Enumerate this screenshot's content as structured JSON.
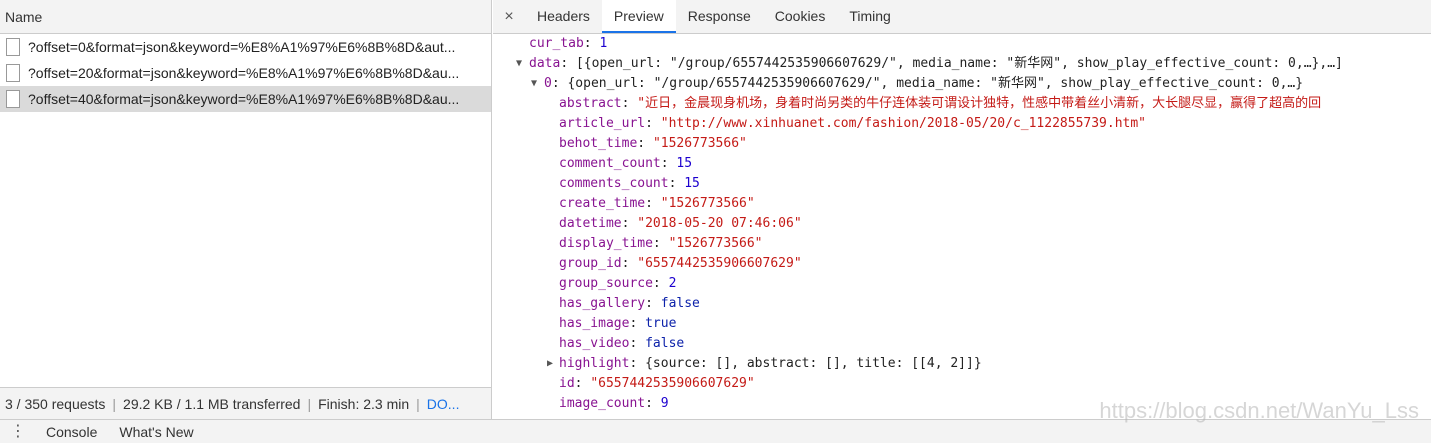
{
  "left": {
    "header": "Name",
    "requests": [
      "?offset=0&format=json&keyword=%E8%A1%97%E6%8B%8D&aut...",
      "?offset=20&format=json&keyword=%E8%A1%97%E6%8B%8D&au...",
      "?offset=40&format=json&keyword=%E8%A1%97%E6%8B%8D&au..."
    ],
    "status": {
      "requests": "3 / 350 requests",
      "transferred": "29.2 KB / 1.1 MB transferred",
      "finish": "Finish: 2.3 min",
      "dom": "DO..."
    }
  },
  "tabs": {
    "close": "×",
    "items": [
      "Headers",
      "Preview",
      "Response",
      "Cookies",
      "Timing"
    ],
    "active": "Preview"
  },
  "preview": {
    "cur_tab": {
      "key": "cur_tab",
      "value": "1"
    },
    "data": {
      "key": "data",
      "summary": "[{open_url: \"/group/6557442535906607629/\", media_name: \"新华网\", show_play_effective_count: 0,…},…]"
    },
    "item0": {
      "key": "0",
      "summary": "{open_url: \"/group/6557442535906607629/\", media_name: \"新华网\", show_play_effective_count: 0,…}"
    },
    "fields": [
      {
        "key": "abstract",
        "value": "\"近日，金晨现身机场，身着时尚另类的牛仔连体装可谓设计独特，性感中带着丝小清新，大长腿尽显，赢得了超高的回",
        "type": "str"
      },
      {
        "key": "article_url",
        "value": "\"http://www.xinhuanet.com/fashion/2018-05/20/c_1122855739.htm\"",
        "type": "str"
      },
      {
        "key": "behot_time",
        "value": "\"1526773566\"",
        "type": "str"
      },
      {
        "key": "comment_count",
        "value": "15",
        "type": "num"
      },
      {
        "key": "comments_count",
        "value": "15",
        "type": "num"
      },
      {
        "key": "create_time",
        "value": "\"1526773566\"",
        "type": "str"
      },
      {
        "key": "datetime",
        "value": "\"2018-05-20 07:46:06\"",
        "type": "str"
      },
      {
        "key": "display_time",
        "value": "\"1526773566\"",
        "type": "str"
      },
      {
        "key": "group_id",
        "value": "\"6557442535906607629\"",
        "type": "str"
      },
      {
        "key": "group_source",
        "value": "2",
        "type": "num"
      },
      {
        "key": "has_gallery",
        "value": "false",
        "type": "kw"
      },
      {
        "key": "has_image",
        "value": "true",
        "type": "kw"
      },
      {
        "key": "has_video",
        "value": "false",
        "type": "kw"
      }
    ],
    "highlight": {
      "key": "highlight",
      "summary": "{source: [], abstract: [], title: [[4, 2]]}"
    },
    "id": {
      "key": "id",
      "value": "\"6557442535906607629\""
    },
    "image_count": {
      "key": "image_count",
      "value": "9"
    }
  },
  "drawer": {
    "tabs": [
      "Console",
      "What's New"
    ]
  },
  "watermark": "https://blog.csdn.net/WanYu_Lss"
}
